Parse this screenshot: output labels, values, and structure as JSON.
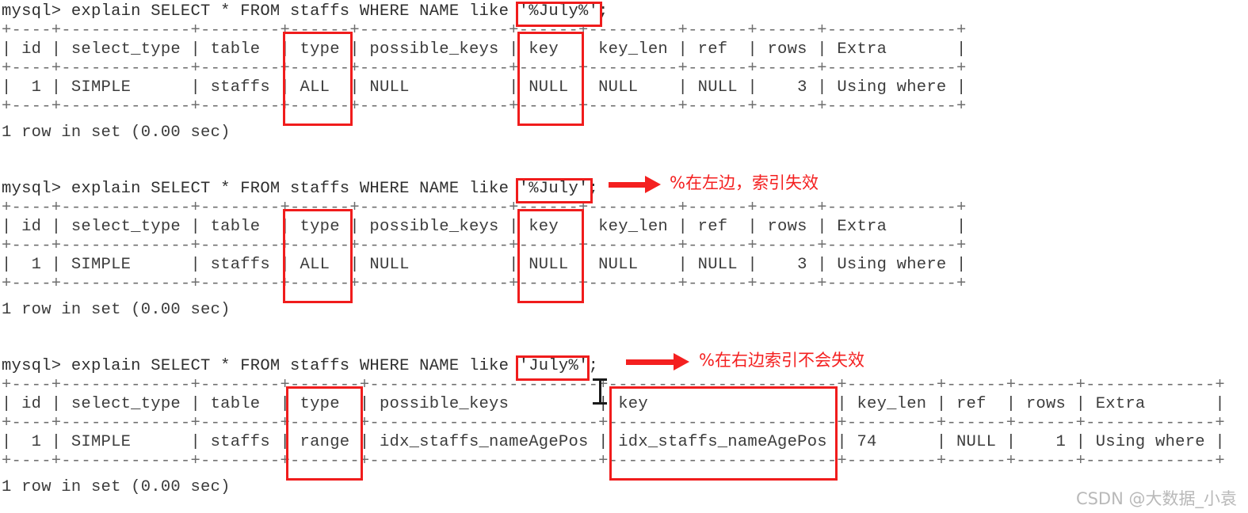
{
  "terminal": {
    "prompt": "mysql> ",
    "blocks": [
      {
        "id": "block-1",
        "command": "mysql> explain SELECT * FROM staffs WHERE NAME like '%July%';",
        "highlighted_literal": "'%July%'",
        "sep_top": "+----+-------------+--------+------+---------------+------+---------+------+------+-------------+",
        "header_row": "| id | select_type | table  | type | possible_keys | key  | key_len | ref  | rows | Extra       |",
        "sep_mid": "+----+-------------+--------+------+---------------+------+---------+------+------+-------------+",
        "data_row": "|  1 | SIMPLE      | staffs | ALL  | NULL          | NULL | NULL    | NULL |    3 | Using where |",
        "sep_bot": "+----+-------------+--------+------+---------------+------+---------+------+------+-------------+",
        "footer": "1 row in set (0.00 sec)",
        "columns": [
          "id",
          "select_type",
          "table",
          "type",
          "possible_keys",
          "key",
          "key_len",
          "ref",
          "rows",
          "Extra"
        ],
        "values": [
          "1",
          "SIMPLE",
          "staffs",
          "ALL",
          "NULL",
          "NULL",
          "NULL",
          "NULL",
          "3",
          "Using where"
        ],
        "annotation": ""
      },
      {
        "id": "block-2",
        "command": "mysql> explain SELECT * FROM staffs WHERE NAME like '%July';",
        "highlighted_literal": "'%July'",
        "sep_top": "+----+-------------+--------+------+---------------+------+---------+------+------+-------------+",
        "header_row": "| id | select_type | table  | type | possible_keys | key  | key_len | ref  | rows | Extra       |",
        "sep_mid": "+----+-------------+--------+------+---------------+------+---------+------+------+-------------+",
        "data_row": "|  1 | SIMPLE      | staffs | ALL  | NULL          | NULL | NULL    | NULL |    3 | Using where |",
        "sep_bot": "+----+-------------+--------+------+---------------+------+---------+------+------+-------------+",
        "footer": "1 row in set (0.00 sec)",
        "columns": [
          "id",
          "select_type",
          "table",
          "type",
          "possible_keys",
          "key",
          "key_len",
          "ref",
          "rows",
          "Extra"
        ],
        "values": [
          "1",
          "SIMPLE",
          "staffs",
          "ALL",
          "NULL",
          "NULL",
          "NULL",
          "NULL",
          "3",
          "Using where"
        ],
        "annotation": "%在左边，索引失效"
      },
      {
        "id": "block-3",
        "command": "mysql> explain SELECT * FROM staffs WHERE NAME like 'July%';",
        "highlighted_literal": "'July%'",
        "sep_top": "+----+-------------+--------+-------+-----------------------+-----------------------+---------+------+------+-------------+",
        "header_row": "| id | select_type | table  | type  | possible_keys         | key                   | key_len | ref  | rows | Extra       |",
        "sep_mid": "+----+-------------+--------+-------+-----------------------+-----------------------+---------+------+------+-------------+",
        "data_row": "|  1 | SIMPLE      | staffs | range | idx_staffs_nameAgePos | idx_staffs_nameAgePos | 74      | NULL |    1 | Using where |",
        "sep_bot": "+----+-------------+--------+-------+-----------------------+-----------------------+---------+------+------+-------------+",
        "footer": "1 row in set (0.00 sec)",
        "columns": [
          "id",
          "select_type",
          "table",
          "type",
          "possible_keys",
          "key",
          "key_len",
          "ref",
          "rows",
          "Extra"
        ],
        "values": [
          "1",
          "SIMPLE",
          "staffs",
          "range",
          "idx_staffs_nameAgePos",
          "idx_staffs_nameAgePos",
          "74",
          "NULL",
          "1",
          "Using where"
        ],
        "annotation": "%在右边索引不会失效"
      }
    ]
  },
  "watermark": "CSDN @大数据_小袁",
  "colors": {
    "highlight": "#f01c1c",
    "arrow": "#f42020",
    "annotation": "#f42020",
    "text": "#3c3c3c",
    "background": "#ffffff",
    "watermark": "#b9b9b9"
  }
}
